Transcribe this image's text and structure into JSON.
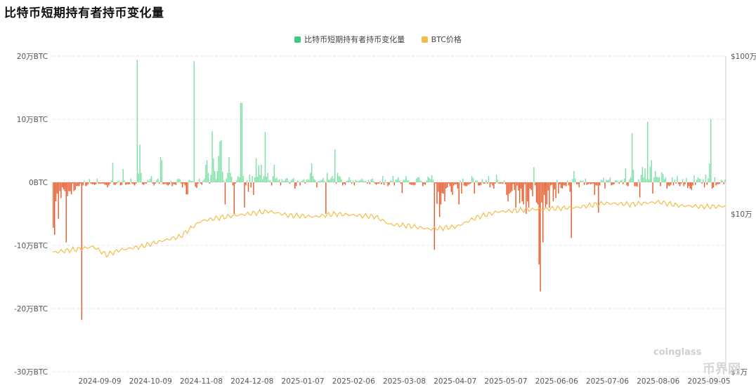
{
  "title": "比特币短期持有者持币变化量",
  "watermark": "coinglass",
  "watermark2": "币界网",
  "legend": [
    {
      "label": "比特币短期持有者持币变化量",
      "color": "#3fc97a"
    },
    {
      "label": "BTC价格",
      "color": "#f3bd4b"
    }
  ],
  "colors": {
    "positive": "#7fe0a6",
    "negative": "#ea5a2c",
    "price": "#f3bd4b",
    "grid": "#e6e6e6"
  },
  "chart_data": {
    "type": "bar",
    "y_left": {
      "ticks": [
        "20万BTC",
        "10万BTC",
        "0BTC",
        "-10万BTC",
        "-20万BTC",
        "-30万BTC"
      ],
      "range": [
        -300000,
        200000
      ]
    },
    "y_right": {
      "ticks": [
        "$100万",
        "$10万",
        "$1万"
      ],
      "scale": "log",
      "range": [
        10000,
        1000000
      ]
    },
    "x_ticks": [
      "2024-09-09",
      "2024-10-09",
      "2024-11-08",
      "2024-12-08",
      "2025-01-07",
      "2025-02-06",
      "2025-03-08",
      "2025-04-07",
      "2025-05-07",
      "2025-06-06",
      "2025-07-06",
      "2025-08-06",
      "2025-09-05"
    ],
    "bar_series_name": "比特币短期持有者持币变化量",
    "bars": [
      -72000,
      -83000,
      -30000,
      -18000,
      -58000,
      -14000,
      -25000,
      -8000,
      -11000,
      -14000,
      -95000,
      -22000,
      -14000,
      -14000,
      -19000,
      -2000,
      -14000,
      -12000,
      -6000,
      -6000,
      -6000,
      -2000,
      -218000,
      -5000,
      3000,
      -6000,
      -5000,
      -3000,
      5000,
      -2000,
      -3000,
      -3000,
      -4000,
      -3000,
      6000,
      -2000,
      -2000,
      -2000,
      -2000,
      -2000,
      -4000,
      -4000,
      -8000,
      -5000,
      -2000,
      3000,
      31000,
      -4000,
      -4000,
      -2000,
      2000,
      2000,
      -5000,
      -4000,
      21000,
      3000,
      -4000,
      -3000,
      -3000,
      -3000,
      6000,
      -2000,
      -3000,
      -5000,
      -2000,
      194000,
      14000,
      60000,
      15000,
      -3000,
      -4000,
      -2000,
      -2000,
      4000,
      2000,
      6000,
      10000,
      -2000,
      -5000,
      -2000,
      4000,
      6000,
      -2000,
      40000,
      35000,
      -3000,
      -3000,
      -2000,
      -4000,
      -5000,
      -3000,
      2000,
      -6000,
      -3000,
      -3000,
      -4000,
      5000,
      6000,
      5000,
      -2000,
      -8000,
      -2000,
      -5000,
      -19000,
      -19000,
      4000,
      3000,
      2000,
      2000,
      192000,
      -7000,
      -9000,
      -2000,
      6000,
      -2000,
      -4000,
      3000,
      6000,
      28000,
      35000,
      15000,
      -2000,
      12000,
      81000,
      38000,
      18000,
      5000,
      18000,
      42000,
      65000,
      67000,
      17000,
      3000,
      -35000,
      6000,
      15000,
      40000,
      15000,
      9000,
      -5000,
      -50000,
      -2000,
      3000,
      10000,
      8000,
      126000,
      126000,
      10000,
      -40000,
      -5000,
      3000,
      -15000,
      12000,
      -8000,
      10000,
      -20000,
      8000,
      38000,
      9000,
      27000,
      12000,
      28000,
      5000,
      10000,
      80000,
      9000,
      15000,
      3000,
      3000,
      -5000,
      10000,
      28000,
      6000,
      8000,
      3000,
      5000,
      -5000,
      5000,
      2000,
      3000,
      6000,
      7000,
      2000,
      -2000,
      3000,
      5000,
      7000,
      -10000,
      -6000,
      3000,
      2000,
      -5000,
      2000,
      3000,
      5000,
      -2000,
      4000,
      5000,
      4000,
      15000,
      30000,
      10000,
      5000,
      3000,
      -8000,
      2000,
      2000,
      3000,
      4000,
      7000,
      2000,
      -50000,
      15000,
      4000,
      4000,
      7000,
      10000,
      6000,
      52000,
      -2000,
      15000,
      10000,
      9000,
      5000,
      -5000,
      -2000,
      -4000,
      2000,
      3000,
      8000,
      4000,
      -2000,
      3000,
      -5000,
      4000,
      2000,
      2000,
      3000,
      4000,
      6000,
      2000,
      2000,
      2000,
      -2000,
      4000,
      -3000,
      5000,
      6000,
      2000,
      -2000,
      -4000,
      -2000,
      -2000,
      2000,
      -3000,
      10000,
      -4000,
      4000,
      -1000,
      -6000,
      -4000,
      3000,
      2000,
      10000,
      -5000,
      4000,
      5000,
      8000,
      3000,
      -2000,
      -17000,
      4000,
      4000,
      10000,
      3000,
      3000,
      -3000,
      -4000,
      -4000,
      -5000,
      -4000,
      6000,
      8000,
      8000,
      3000,
      2000,
      -6000,
      -3000,
      -4000,
      3000,
      9000,
      7000,
      5000,
      11000,
      4000,
      -107000,
      -2000,
      -34000,
      -15000,
      -55000,
      -35000,
      -17000,
      -18000,
      -30000,
      -10000,
      -8000,
      -2000,
      -6000,
      -15000,
      -20000,
      -5000,
      -3000,
      -3000,
      -10000,
      -35000,
      3000,
      -18000,
      6000,
      -5000,
      -6000,
      -6000,
      -4000,
      -3000,
      -2000,
      10000,
      7000,
      -18000,
      3000,
      3000,
      -5000,
      -5000,
      -4000,
      5000,
      -2000,
      -2000,
      4000,
      -2000,
      10000,
      -8000,
      -2000,
      -5000,
      -10000,
      -2000,
      12000,
      4000,
      -2000,
      -2000,
      -2000,
      -2000,
      3000,
      -3000,
      -20000,
      -30000,
      -18000,
      -16000,
      -14000,
      -3000,
      -12000,
      -40000,
      -5000,
      -13000,
      -33000,
      -10000,
      -30000,
      -35000,
      -3000,
      -50000,
      -30000,
      -40000,
      -10000,
      -12000,
      -22000,
      24000,
      -5000,
      -32000,
      -35000,
      -130000,
      -173000,
      -32000,
      -95000,
      -20000,
      -40000,
      -35000,
      -13000,
      -40000,
      -5000,
      -4000,
      -30000,
      -11000,
      -25000,
      4000,
      -18000,
      -3000,
      -9000,
      -10000,
      -5000,
      -5000,
      -6000,
      3000,
      -5000,
      -15000,
      -88000,
      5000,
      18000,
      6000,
      -3000,
      -3000,
      -8000,
      3000,
      2000,
      3000,
      -4000,
      6000,
      -4000,
      -3000,
      -2000,
      -3000,
      -2000,
      -2000,
      -20000,
      -5000,
      -5000,
      -48000,
      -5000,
      4000,
      3000,
      7000,
      -10000,
      4000,
      3000,
      4000,
      8000,
      -5000,
      -4000,
      -3000,
      3000,
      3000,
      2000,
      -2000,
      3000,
      4000,
      -3000,
      6000,
      22000,
      -5000,
      -6000,
      5000,
      8000,
      78000,
      20000,
      -6000,
      -6000,
      -7000,
      5000,
      -24000,
      12000,
      24000,
      8000,
      22000,
      5000,
      96000,
      5000,
      25000,
      35000,
      -18000,
      8000,
      18000,
      9000,
      8000,
      8000,
      -6000,
      16000,
      13000,
      5000,
      8000,
      -10000,
      -5000,
      -6000,
      -4000,
      8000,
      -5000,
      4000,
      -2000,
      10000,
      -3000,
      -6000,
      -2000,
      5000,
      -6000,
      -3000,
      7000,
      -9000,
      -6000,
      -10000,
      -12000,
      -5000,
      11000,
      -4000,
      4000,
      8000,
      6000,
      5000,
      -2000,
      5000,
      -8000,
      12000,
      -4000,
      6000,
      30000,
      100000,
      -10000,
      -8000,
      8000,
      -5000,
      -3000,
      -3000,
      -2000,
      4000,
      3000,
      -3000,
      5000
    ]
  }
}
